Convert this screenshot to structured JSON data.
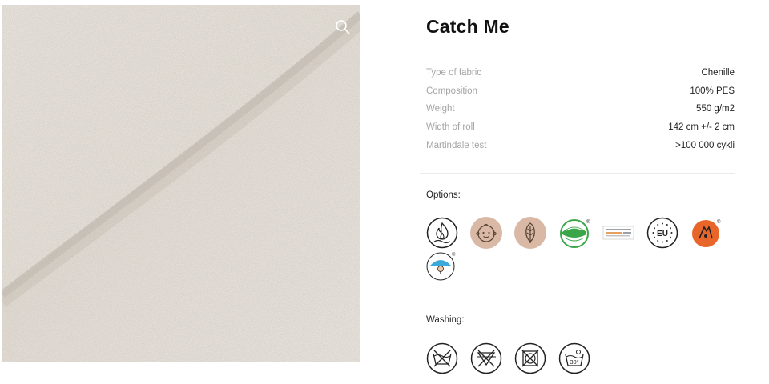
{
  "product": {
    "title": "Catch Me"
  },
  "specs": [
    {
      "label": "Type of fabric",
      "value": "Chenille"
    },
    {
      "label": "Composition",
      "value": "100% PES"
    },
    {
      "label": "Weight",
      "value": "550 g/m2"
    },
    {
      "label": "Width of roll",
      "value": "142 cm +/- 2 cm"
    },
    {
      "label": "Martindale test",
      "value": ">100 000 cykli"
    }
  ],
  "options": {
    "label": "Options:",
    "icons": [
      "flame-retardant-icon",
      "baby-safe-icon",
      "eco-leaf-icon",
      "certificate-badge-icon",
      "oeko-tex-label-icon",
      "eu-stars-icon",
      "pet-friendly-icon",
      "umbrella-water-repellent-icon"
    ]
  },
  "washing": {
    "label": "Washing:",
    "icons": [
      "do-not-wash-icon",
      "do-not-tumble-dry-icon",
      "do-not-dry-clean-icon",
      "wash-30-icon"
    ],
    "wash_temp": "30°"
  },
  "colors": {
    "fabric": "#ece6df",
    "tan_circle": "#d9b8a5",
    "green": "#3aa648",
    "orange": "#e8662a",
    "blue": "#3ba9d9"
  }
}
